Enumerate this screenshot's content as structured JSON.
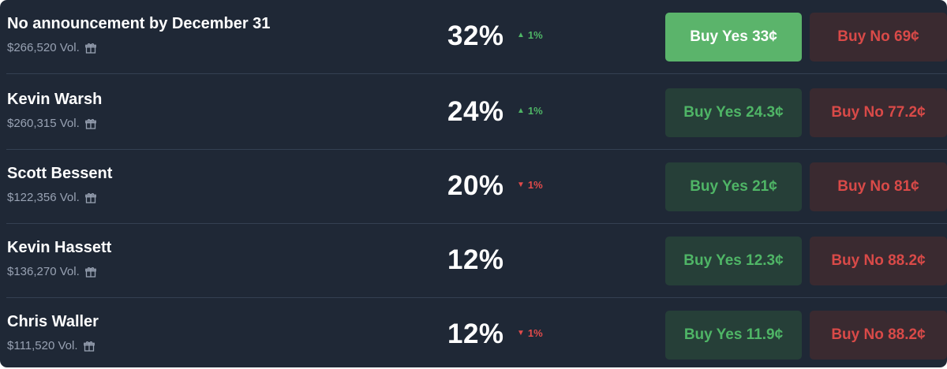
{
  "outcomes": [
    {
      "name": "No announcement by December 31",
      "volume": "$266,520 Vol.",
      "percent": "32%",
      "change": "1%",
      "change_direction": "up",
      "change_arrow": "▲",
      "yes_label": "Buy Yes 33¢",
      "no_label": "Buy No 69¢",
      "yes_active": true
    },
    {
      "name": "Kevin Warsh",
      "volume": "$260,315 Vol.",
      "percent": "24%",
      "change": "1%",
      "change_direction": "up",
      "change_arrow": "▲",
      "yes_label": "Buy Yes 24.3¢",
      "no_label": "Buy No 77.2¢",
      "yes_active": false
    },
    {
      "name": "Scott Bessent",
      "volume": "$122,356 Vol.",
      "percent": "20%",
      "change": "1%",
      "change_direction": "down",
      "change_arrow": "▼",
      "yes_label": "Buy Yes 21¢",
      "no_label": "Buy No 81¢",
      "yes_active": false
    },
    {
      "name": "Kevin Hassett",
      "volume": "$136,270 Vol.",
      "percent": "12%",
      "change": "",
      "change_direction": "none",
      "change_arrow": "",
      "yes_label": "Buy Yes 12.3¢",
      "no_label": "Buy No 88.2¢",
      "yes_active": false
    },
    {
      "name": "Chris Waller",
      "volume": "$111,520 Vol.",
      "percent": "12%",
      "change": "1%",
      "change_direction": "down",
      "change_arrow": "▼",
      "yes_label": "Buy Yes 11.9¢",
      "no_label": "Buy No 88.2¢",
      "yes_active": false
    }
  ],
  "icons": {
    "volume_icon": "gift-icon",
    "up_icon": "triangle-up-icon",
    "down_icon": "heart-down-icon"
  },
  "colors": {
    "background": "#1f2836",
    "yes_green": "#4fb566",
    "yes_active_bg": "#5bb46b",
    "no_red": "#d94a48",
    "down_red": "#e14b4b"
  }
}
